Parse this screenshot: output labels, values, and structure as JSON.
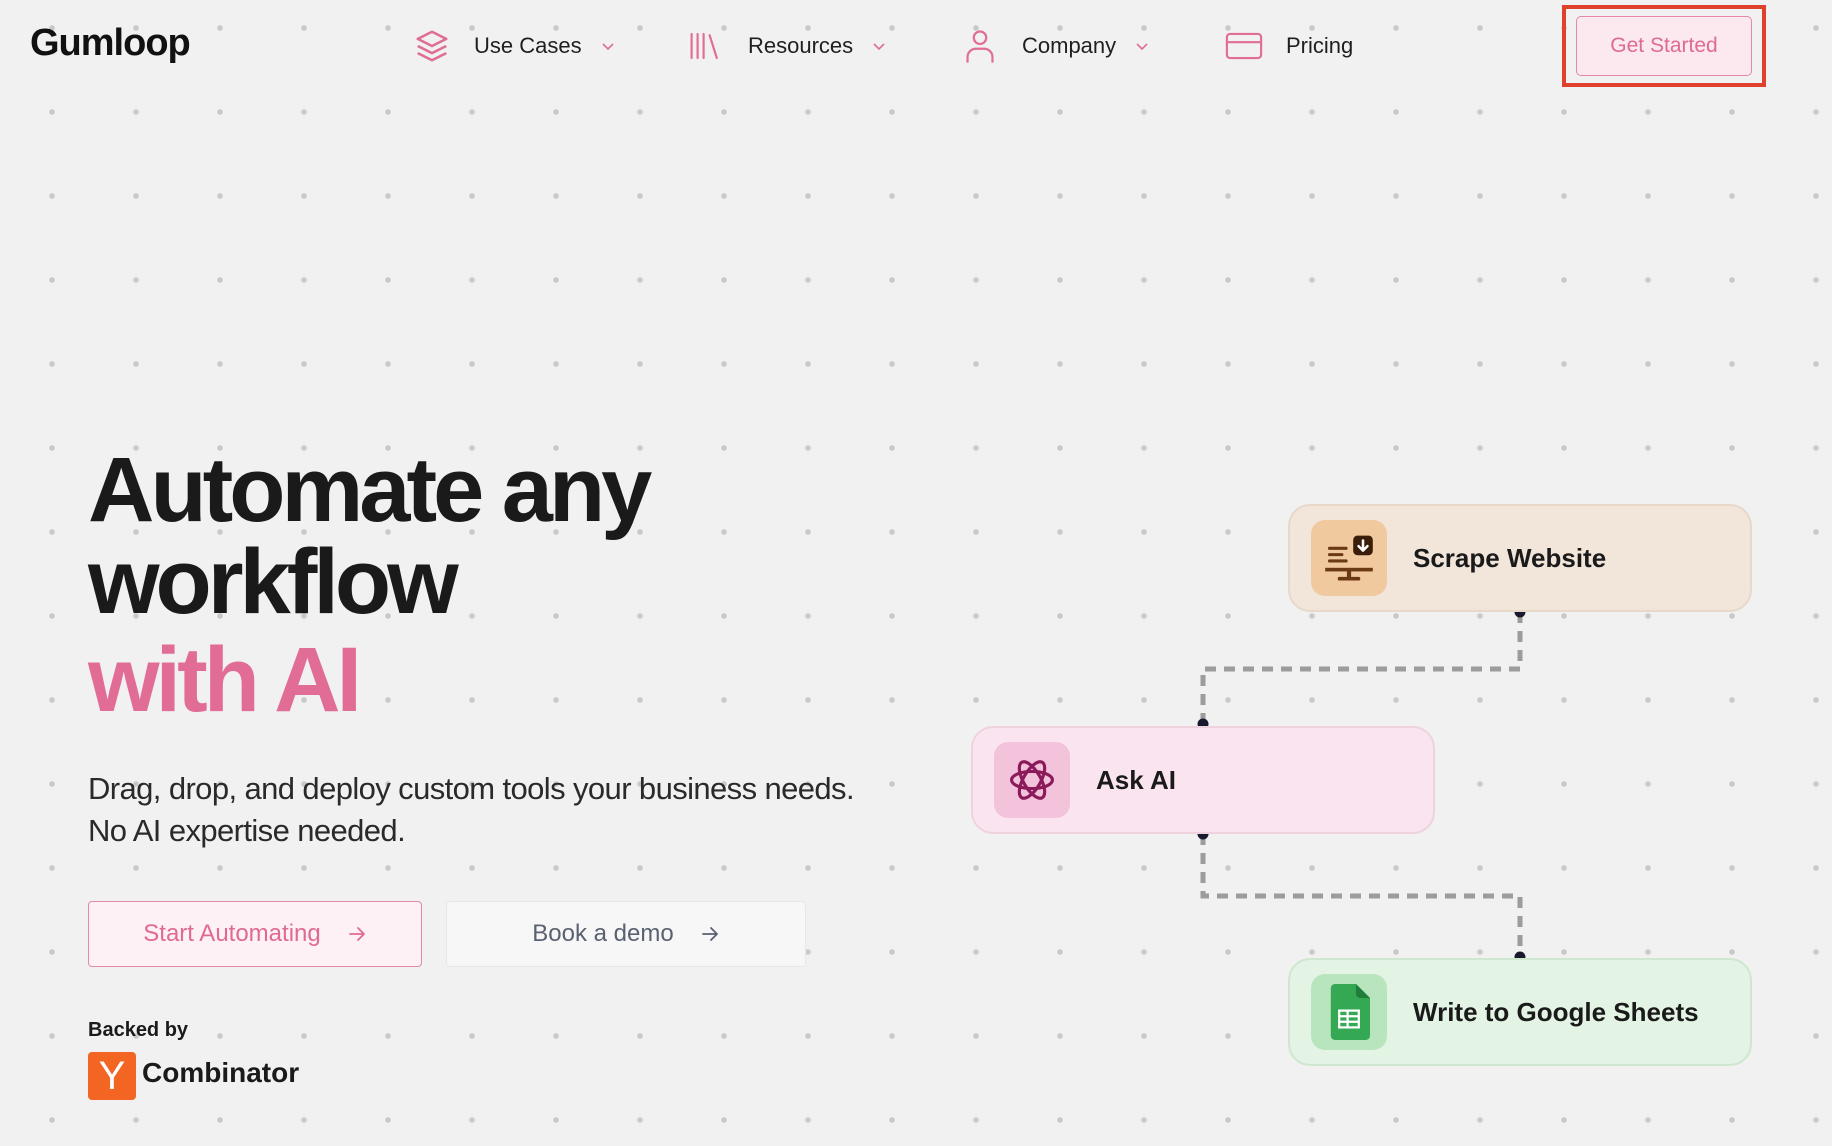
{
  "brand": {
    "logo_text": "Gumloop"
  },
  "nav": {
    "items": [
      {
        "label": "Use Cases",
        "icon": "layers-icon",
        "has_dropdown": true
      },
      {
        "label": "Resources",
        "icon": "library-icon",
        "has_dropdown": true
      },
      {
        "label": "Company",
        "icon": "user-icon",
        "has_dropdown": true
      },
      {
        "label": "Pricing",
        "icon": "credit-card-icon",
        "has_dropdown": false
      }
    ],
    "cta_label": "Get Started"
  },
  "hero": {
    "headline_line1": "Automate any",
    "headline_line2": "workflow",
    "headline_line3": "with AI",
    "subtitle_line1": "Drag, drop, and deploy custom tools your business needs.",
    "subtitle_line2": "No AI expertise needed.",
    "primary_cta": "Start Automating",
    "secondary_cta": "Book a demo",
    "backed_by_label": "Backed by",
    "backer_logo_letter": "Y",
    "backer_name": "Combinator"
  },
  "flow": {
    "nodes": [
      {
        "label": "Scrape Website",
        "icon": "scrape-website-icon"
      },
      {
        "label": "Ask AI",
        "icon": "openai-icon"
      },
      {
        "label": "Write to Google Sheets",
        "icon": "google-sheets-icon"
      }
    ]
  },
  "colors": {
    "accent_pink": "#e16d96",
    "highlight_red": "#e0412c",
    "yc_orange": "#f26522",
    "background": "#f1f1f1"
  }
}
